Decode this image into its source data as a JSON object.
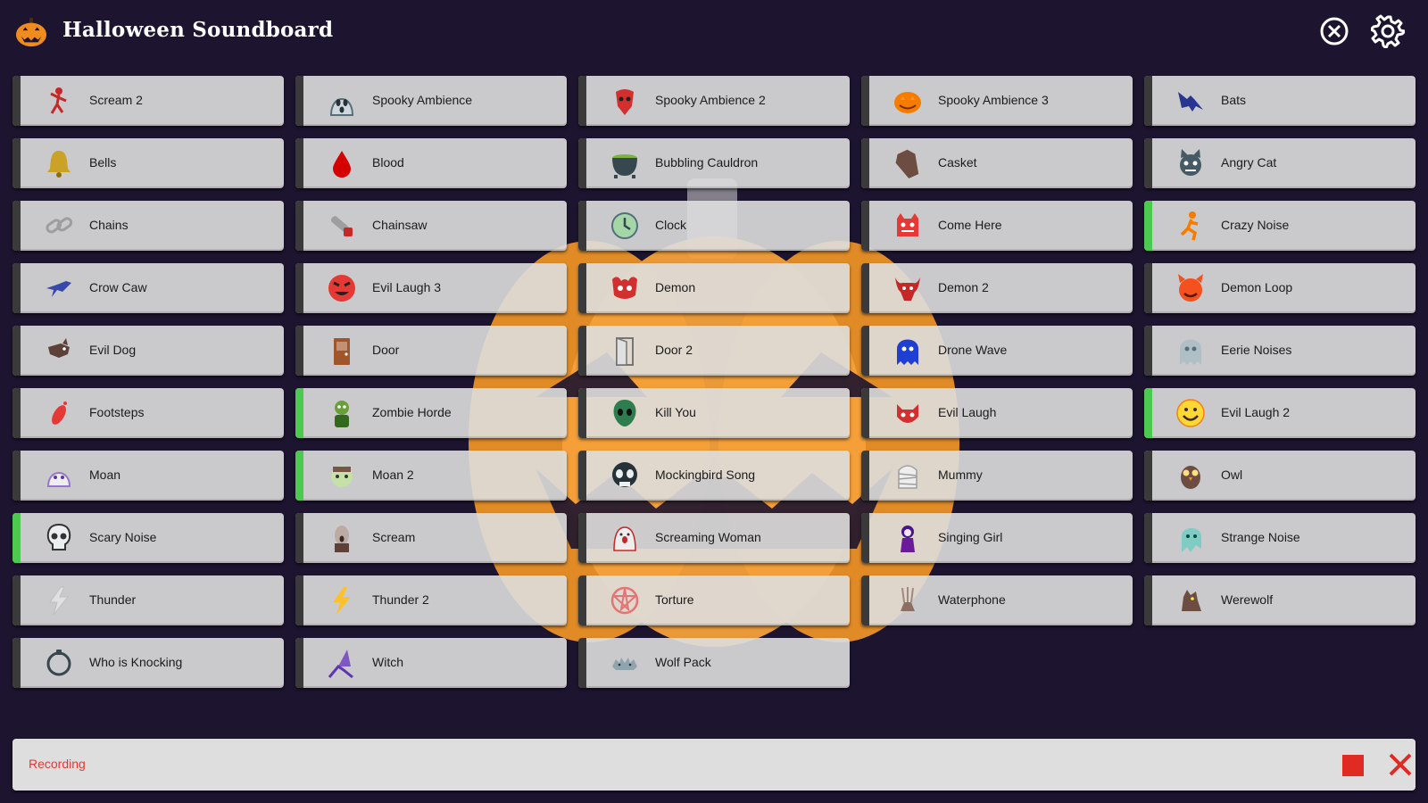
{
  "app": {
    "title": "Halloween Soundboard"
  },
  "colors": {
    "background": "#1d1430",
    "button": "#dedede",
    "active_indicator": "#4cc94f",
    "recording_text": "#e53935",
    "accent": "#f08c1e"
  },
  "sounds": [
    {
      "label": "Scream 2",
      "icon": "dancing-skeleton-icon",
      "active": false
    },
    {
      "label": "Spooky Ambience",
      "icon": "ghost-face-icon",
      "active": false
    },
    {
      "label": "Spooky Ambience 2",
      "icon": "red-mask-icon",
      "active": false
    },
    {
      "label": "Spooky Ambience 3",
      "icon": "jack-o-lantern-icon",
      "active": false
    },
    {
      "label": "Bats",
      "icon": "bat-icon",
      "active": false
    },
    {
      "label": "Bells",
      "icon": "bell-icon",
      "active": false
    },
    {
      "label": "Blood",
      "icon": "blood-drop-icon",
      "active": false
    },
    {
      "label": "Bubbling Cauldron",
      "icon": "cauldron-icon",
      "active": false
    },
    {
      "label": "Casket",
      "icon": "coffin-icon",
      "active": false
    },
    {
      "label": "Angry Cat",
      "icon": "cat-icon",
      "active": false
    },
    {
      "label": "Chains",
      "icon": "chain-icon",
      "active": false
    },
    {
      "label": "Chainsaw",
      "icon": "chainsaw-icon",
      "active": false
    },
    {
      "label": "Clock",
      "icon": "clock-icon",
      "active": false
    },
    {
      "label": "Come Here",
      "icon": "red-monster-icon",
      "active": false
    },
    {
      "label": "Crazy Noise",
      "icon": "running-figure-icon",
      "active": true
    },
    {
      "label": "Crow Caw",
      "icon": "crow-icon",
      "active": false
    },
    {
      "label": "Evil Laugh 3",
      "icon": "evil-face-icon",
      "active": false
    },
    {
      "label": "Demon",
      "icon": "demon-icon",
      "active": false
    },
    {
      "label": "Demon 2",
      "icon": "bull-demon-icon",
      "active": false
    },
    {
      "label": "Demon Loop",
      "icon": "devil-face-icon",
      "active": false
    },
    {
      "label": "Evil Dog",
      "icon": "dog-icon",
      "active": false
    },
    {
      "label": "Door",
      "icon": "door-icon",
      "active": false
    },
    {
      "label": "Door 2",
      "icon": "open-door-icon",
      "active": false
    },
    {
      "label": "Drone Wave",
      "icon": "blue-ghost-icon",
      "active": false
    },
    {
      "label": "Eerie Noises",
      "icon": "pale-ghost-icon",
      "active": false
    },
    {
      "label": "Footsteps",
      "icon": "footprint-icon",
      "active": false
    },
    {
      "label": "Zombie Horde",
      "icon": "zombie-icon",
      "active": true
    },
    {
      "label": "Kill You",
      "icon": "alien-skull-icon",
      "active": false
    },
    {
      "label": "Evil Laugh",
      "icon": "devil-head-icon",
      "active": false
    },
    {
      "label": "Evil Laugh 2",
      "icon": "smiley-icon",
      "active": true
    },
    {
      "label": "Moan",
      "icon": "moaning-ghost-icon",
      "active": false
    },
    {
      "label": "Moan 2",
      "icon": "zombie-head-icon",
      "active": true
    },
    {
      "label": "Mockingbird Song",
      "icon": "skull-mask-icon",
      "active": false
    },
    {
      "label": "Mummy",
      "icon": "mummy-icon",
      "active": false
    },
    {
      "label": "Owl",
      "icon": "owl-icon",
      "active": false
    },
    {
      "label": "Scary Noise",
      "icon": "skull-icon",
      "active": true
    },
    {
      "label": "Scream",
      "icon": "screaming-man-icon",
      "active": false
    },
    {
      "label": "Screaming Woman",
      "icon": "screaming-woman-icon",
      "active": false
    },
    {
      "label": "Singing Girl",
      "icon": "girl-icon",
      "active": false
    },
    {
      "label": "Strange Noise",
      "icon": "teal-ghost-icon",
      "active": false
    },
    {
      "label": "Thunder",
      "icon": "grey-lightning-icon",
      "active": false
    },
    {
      "label": "Thunder 2",
      "icon": "yellow-lightning-icon",
      "active": false
    },
    {
      "label": "Torture",
      "icon": "pentagram-icon",
      "active": false
    },
    {
      "label": "Waterphone",
      "icon": "waterphone-icon",
      "active": false
    },
    {
      "label": "Werewolf",
      "icon": "werewolf-icon",
      "active": false
    },
    {
      "label": "Who is Knocking",
      "icon": "door-knocker-icon",
      "active": false
    },
    {
      "label": "Witch",
      "icon": "witch-icon",
      "active": false
    },
    {
      "label": "Wolf Pack",
      "icon": "wolves-icon",
      "active": false
    }
  ],
  "recording": {
    "label": "Recording"
  }
}
